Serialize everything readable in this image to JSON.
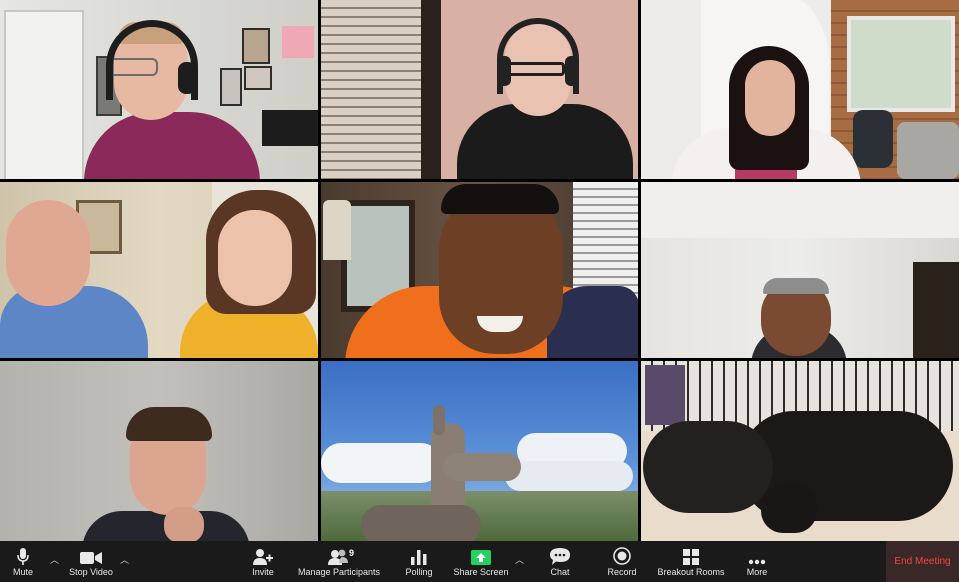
{
  "toolbar": {
    "mute": "Mute",
    "stop_video": "Stop Video",
    "invite": "Invite",
    "manage_participants": "Manage Participants",
    "participant_count": "9",
    "polling": "Polling",
    "share_screen": "Share Screen",
    "chat": "Chat",
    "record": "Record",
    "breakout_rooms": "Breakout Rooms",
    "more": "More",
    "end_meeting": "End Meeting"
  },
  "colors": {
    "toolbar_bg": "#1a1a1a",
    "active_speaker_border": "#6fc134",
    "share_green": "#23d160",
    "end_meeting_red": "#f0483e"
  },
  "icons": [
    "microphone-icon",
    "video-camera-icon",
    "invite-user-icon",
    "participants-icon",
    "bar-chart-icon",
    "share-screen-icon",
    "chat-bubble-icon",
    "record-icon",
    "breakout-grid-icon",
    "more-dots-icon"
  ]
}
